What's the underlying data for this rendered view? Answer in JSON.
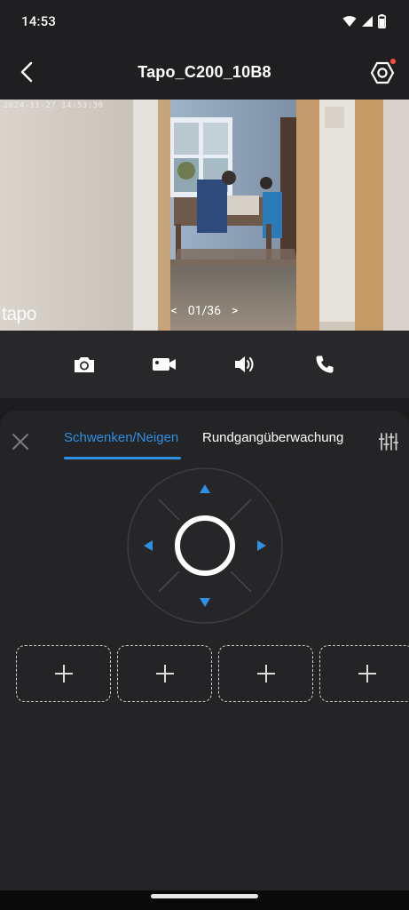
{
  "status_bar": {
    "time": "14:53"
  },
  "app_bar": {
    "title": "Tapo_C200_10B8"
  },
  "video": {
    "timestamp": "2024-11-27 14:53:30",
    "logo_text": "tapo",
    "pager": {
      "prev": "<",
      "current": "01/36",
      "next": ">"
    }
  },
  "toolbar": {
    "icons": [
      "camera-icon",
      "video-record-icon",
      "speaker-icon",
      "phone-icon"
    ]
  },
  "panel": {
    "tabs": [
      {
        "label": "Schwenken/Neigen",
        "active": true
      },
      {
        "label": "Rundgangüberwachung",
        "active": false
      }
    ],
    "preset_add_label": "+"
  },
  "colors": {
    "accent": "#2e8fe3",
    "background": "#1c1c1e",
    "panel": "#242426",
    "notification_dot": "#ff4d3d"
  }
}
